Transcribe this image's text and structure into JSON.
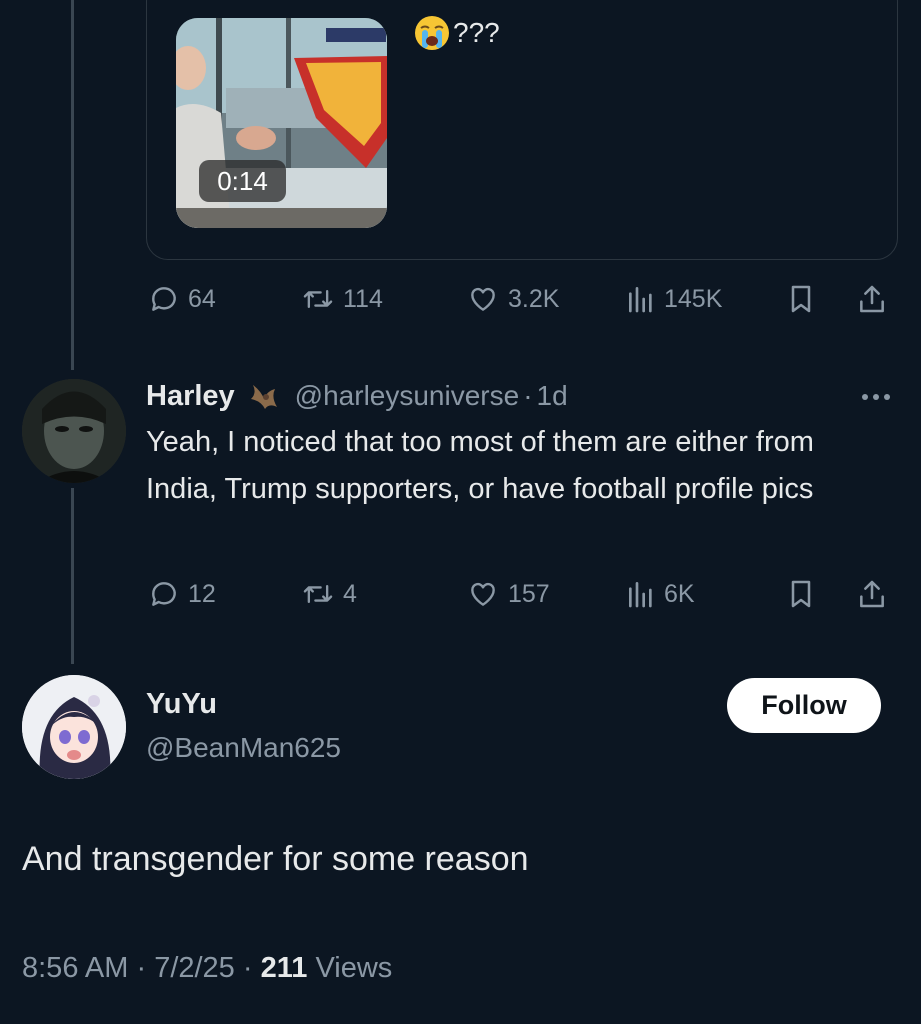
{
  "quoted": {
    "duration": "0:14",
    "text": "???",
    "emoji": "loudly-crying-face",
    "stats": {
      "replies": "64",
      "reposts": "114",
      "likes": "3.2K",
      "views": "145K"
    }
  },
  "reply": {
    "name": "Harley",
    "handle": "@harleysuniverse",
    "time": "1d",
    "text": "Yeah, I noticed that too most of them are either from India, Trump supporters, or have football profile pics",
    "stats": {
      "replies": "12",
      "reposts": "4",
      "likes": "157",
      "views": "6K"
    }
  },
  "main": {
    "name": "YuYu",
    "handle": "@BeanMan625",
    "follow_label": "Follow",
    "text": "And transgender for some reason",
    "time": "8:56 AM",
    "date": "7/2/25",
    "views_count": "211",
    "views_label": "Views"
  },
  "colors": {
    "background": "#0c1622",
    "muted": "#8b98a5",
    "text": "#e7e9ea"
  }
}
